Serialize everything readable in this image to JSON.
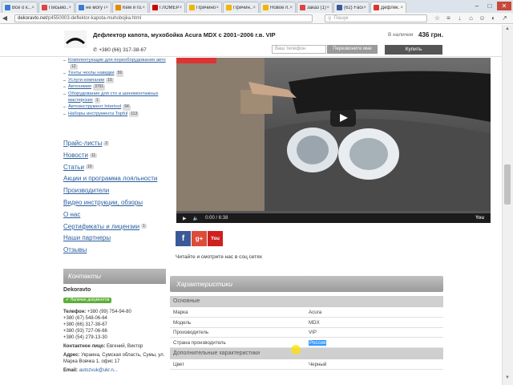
{
  "browser": {
    "tabs": [
      {
        "label": "Все о к...",
        "color": "#3a7bd5"
      },
      {
        "label": "Письмо...",
        "color": "#d44"
      },
      {
        "label": "не могу с...",
        "color": "#3a7bd5"
      },
      {
        "label": "Кем я го...",
        "color": "#e58a00"
      },
      {
        "label": "ГЛОМЕР...",
        "color": "#cc0000"
      },
      {
        "label": "Причино...",
        "color": "#f2b500"
      },
      {
        "label": "Причин...",
        "color": "#f2b500"
      },
      {
        "label": "Новое п...",
        "color": "#f2b500"
      },
      {
        "label": "заказ (1)...",
        "color": "#d44"
      },
      {
        "label": "(62) Face...",
        "color": "#3b5998"
      },
      {
        "label": "Дефлек...",
        "color": "#d33",
        "active": true
      }
    ],
    "url_domain": "dekoravto.net",
    "url_path": "/p4550003-deflektor-kapota-muhobojka.html",
    "search_placeholder": "Пошук"
  },
  "header": {
    "title": "Дефлектор капота, мухобойка Acura MDX с 2001–2006 г.в. VIP",
    "stock_label": "В наличии",
    "price": "436 грн.",
    "phone": "+380 (66) 317-38-67",
    "phone_placeholder": "Ваш телефон",
    "call_button": "Перезвоните мне",
    "buy_button": "Купить"
  },
  "sidebar": {
    "subcategories": [
      {
        "label": "Комплектующие для переоборудования авто",
        "count": "12"
      },
      {
        "label": "Тенты чехлы накидки",
        "count": "59"
      },
      {
        "label": "Услуги компании",
        "count": "16"
      },
      {
        "label": "Автохимия",
        "count": "3791"
      },
      {
        "label": "Оборудование для сто и шиномонтажных мастерских",
        "count": "1"
      },
      {
        "label": "Автоинструмент Intertool",
        "count": "94"
      },
      {
        "label": "Наборы инструмента Topful",
        "count": "113"
      }
    ],
    "links": [
      {
        "label": "Прайс-листы",
        "count": "2"
      },
      {
        "label": "Новости",
        "count": "11"
      },
      {
        "label": "Статьи",
        "count": "10"
      },
      {
        "label": "Акции и программа лояльности",
        "count": ""
      },
      {
        "label": "Производители",
        "count": ""
      },
      {
        "label": "Видео инструкции, обзоры",
        "count": ""
      },
      {
        "label": "О нас",
        "count": ""
      },
      {
        "label": "Сертификаты и лицензии",
        "count": "1"
      },
      {
        "label": "Наши партнеры",
        "count": ""
      },
      {
        "label": "Отзывы",
        "count": ""
      }
    ]
  },
  "contacts": {
    "heading": "Контакты",
    "company": "Dekoravto",
    "badge": "✔ Наличие документов",
    "phone_label": "Телефон:",
    "phones": [
      "+380 (99) 754-94-80",
      "+380 (67) 548-06-64",
      "+380 (66) 317-38-67",
      "+380 (93) 727-06-66",
      "+380 (54) 279-13-30"
    ],
    "contact_label": "Контактное лицо:",
    "contact_name": "Евгений, Виктор",
    "address_label": "Адрес:",
    "address": "Украина, Сумская область, Сумы, ул. Марка Вовчка 1, офис 17",
    "email_label": "Email:",
    "email": "autozvuk@ukr.n..."
  },
  "video": {
    "time": "0:00 / 6:38",
    "brand": "You"
  },
  "social": {
    "caption": "Читайте и смотрите нас в соц сетях",
    "facebook": "f",
    "google": "g+",
    "youtube": "You"
  },
  "specs": {
    "heading": "Характеристики",
    "main_section": "Основные",
    "rows": [
      {
        "key": "Марка",
        "value": "Acura"
      },
      {
        "key": "Модель",
        "value": "MDX"
      },
      {
        "key": "Производитель",
        "value": "VIP"
      },
      {
        "key": "Страна производитель",
        "value": "Россия"
      }
    ],
    "extra_section": "Дополнительные характеристики",
    "extra_rows": [
      {
        "key": "Цвет",
        "value": "Черный"
      }
    ]
  }
}
